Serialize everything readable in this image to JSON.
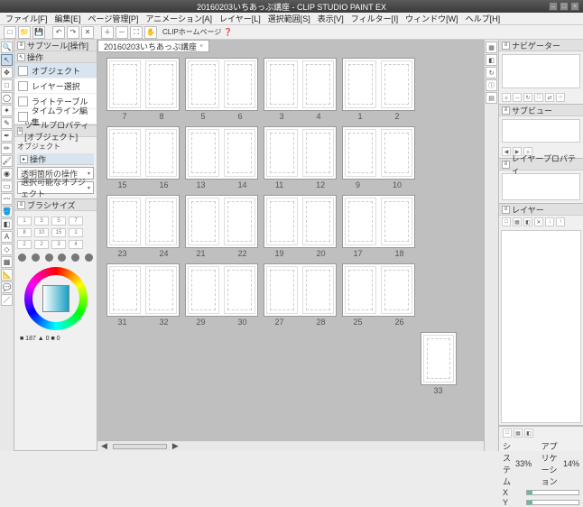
{
  "app": {
    "title": "20160203いちあっぷ講座 - CLIP STUDIO PAINT EX"
  },
  "menu": [
    "ファイル[F]",
    "編集[E]",
    "ページ管理[P]",
    "アニメーション[A]",
    "レイヤー[L]",
    "選択範囲[S]",
    "表示[V]",
    "フィルター[I]",
    "ウィンドウ[W]",
    "ヘルプ[H]"
  ],
  "toolbar_help": "CLIPホームページ ❓",
  "document_tab": "20160203いちあっぷ講座",
  "panels": {
    "subtool_title": "サブツール[操作]",
    "subtool_tab": "操作",
    "subtool_items": [
      "オブジェクト",
      "レイヤー選択",
      "ライトテーブル",
      "タイムライン編集"
    ],
    "toolprop_title": "ツールプロパティ[オブジェクト]",
    "toolprop_sub": "オブジェクト",
    "toolprop_group": "操作",
    "dropdown1": "透明箇所の操作",
    "dropdown2": "選択可能なオブジェクト",
    "brushsize_title": "ブラシサイズ",
    "brush_presets": [
      "1",
      "3",
      "5",
      "7",
      "8",
      "10",
      "15",
      "1",
      "2",
      "2",
      "3",
      "4"
    ],
    "color_readout": "■ 187 ▲ 0 ■ 0",
    "navigator_title": "ナビゲーター",
    "subview_title": "サブビュー",
    "layerprop_title": "レイヤープロパティ",
    "layer_title": "レイヤー"
  },
  "cpu": {
    "sys_label": "システム",
    "sys_value": "33%",
    "app_label": "アプリケーション",
    "app_value": "14%",
    "x_label": "X",
    "y_label": "Y"
  },
  "spreads": [
    [
      [
        "7",
        "8"
      ],
      [
        "5",
        "6"
      ],
      [
        "3",
        "4"
      ],
      [
        "1",
        "2"
      ]
    ],
    [
      [
        "15",
        "16"
      ],
      [
        "13",
        "14"
      ],
      [
        "11",
        "12"
      ],
      [
        "9",
        "10"
      ]
    ],
    [
      [
        "23",
        "24"
      ],
      [
        "21",
        "22"
      ],
      [
        "19",
        "20"
      ],
      [
        "17",
        "18"
      ]
    ],
    [
      [
        "31",
        "32"
      ],
      [
        "29",
        "30"
      ],
      [
        "27",
        "28"
      ],
      [
        "25",
        "26"
      ]
    ]
  ],
  "last_page": "33"
}
